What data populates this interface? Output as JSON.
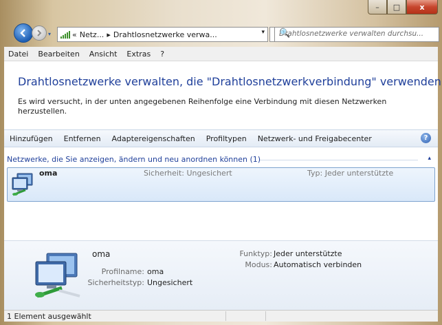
{
  "window": {
    "minimize_label": "–",
    "maximize_label": "□",
    "close_label": "x"
  },
  "nav": {
    "history_label": "▾",
    "breadcrumb_prefix": "«",
    "breadcrumb": [
      "Netz...",
      "▸",
      "Drahtlosnetzwerke verwa..."
    ],
    "address_dropdown": "▾",
    "refresh_icon": "↻",
    "search_placeholder": "Drahtlosnetzwerke verwalten durchsu...",
    "search_icon": "🔍"
  },
  "menu": [
    "Datei",
    "Bearbeiten",
    "Ansicht",
    "Extras",
    "?"
  ],
  "main": {
    "title": "Drahtlosnetzwerke verwalten, die \"Drahtlosnetzwerkverbindung\" verwenden",
    "description": "Es wird versucht, in der unten angegebenen Reihenfolge eine Verbindung mit diesen Netzwerken herzustellen."
  },
  "commands": [
    "Hinzufügen",
    "Entfernen",
    "Adaptereigenschaften",
    "Profiltypen",
    "Netzwerk- und Freigabecenter"
  ],
  "help_label": "?",
  "group": {
    "label": "Netzwerke, die Sie anzeigen, ändern und neu anordnen können (1)",
    "chevron": "▴"
  },
  "networks": [
    {
      "name": "oma",
      "security": "Sicherheit: Ungesichert",
      "type": "Typ: Jeder unterstützte"
    }
  ],
  "details": {
    "name": "oma",
    "profile_label": "Profilname:",
    "profile_value": "oma",
    "security_label": "Sicherheitstyp:",
    "security_value": "Ungesichert",
    "radio_label": "Funktyp:",
    "radio_value": "Jeder unterstützte",
    "mode_label": "Modus:",
    "mode_value": "Automatisch verbinden"
  },
  "status": {
    "text": "1 Element ausgewählt"
  },
  "colors": {
    "title_blue": "#1f3f9a",
    "accent": "#1e5fb4"
  }
}
